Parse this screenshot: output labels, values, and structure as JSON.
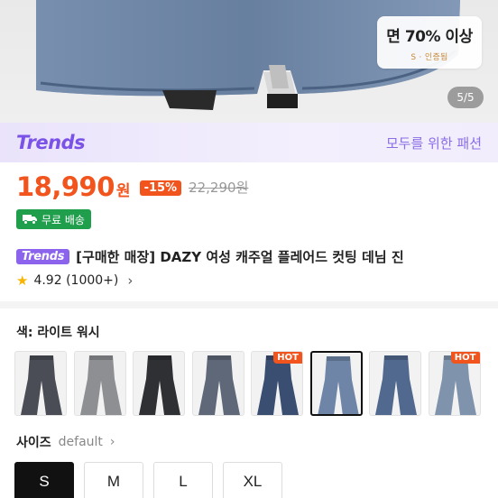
{
  "hero": {
    "promo_main": "면 70% 이상",
    "promo_sub": "S · 인증됨",
    "page_counter": "5/5"
  },
  "banner": {
    "logo": "Trends",
    "tagline": "모두를 위한 패션"
  },
  "price": {
    "amount": "18,990",
    "unit": "원",
    "discount": "-15%",
    "original": "22,290원"
  },
  "shipping": {
    "icon": "truck-icon",
    "label": "무료 배송"
  },
  "product": {
    "brand_chip": "Trends",
    "title": "[구매한 매장] DAZY 여성 캐주얼 플레어드 컷팅 데님 진"
  },
  "rating": {
    "icon": "star-icon",
    "value": "4.92 (1000+)"
  },
  "color": {
    "label": "색: 라이트 워시",
    "options": [
      {
        "hot": false,
        "tone": "#4a4d55"
      },
      {
        "hot": false,
        "tone": "#8d8f93"
      },
      {
        "hot": false,
        "tone": "#2f3034"
      },
      {
        "hot": false,
        "tone": "#5f6878"
      },
      {
        "hot": true,
        "tone": "#3a4e72"
      },
      {
        "hot": false,
        "tone": "#6e85a8",
        "selected": true
      },
      {
        "hot": false,
        "tone": "#52698f"
      },
      {
        "hot": true,
        "tone": "#7f93ac"
      }
    ],
    "hot_label": "HOT"
  },
  "size": {
    "title": "사이즈",
    "default_label": "default",
    "options": [
      "S",
      "M",
      "L",
      "XL"
    ],
    "selected": "S"
  },
  "colors": {
    "accent": "#f1541c",
    "trends_purple": "#7a52e8",
    "shipping_green": "#1f9e4c"
  }
}
